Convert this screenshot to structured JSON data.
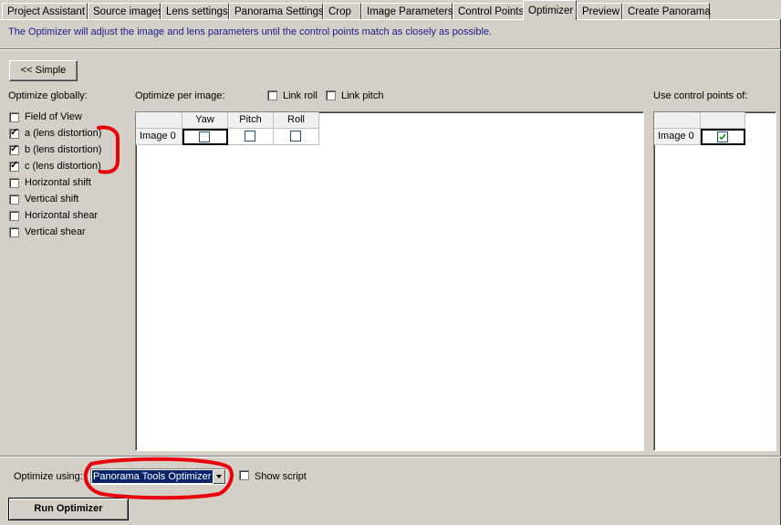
{
  "tabs": [
    {
      "label": "Project Assistant"
    },
    {
      "label": "Source images"
    },
    {
      "label": "Lens settings"
    },
    {
      "label": "Panorama Settings"
    },
    {
      "label": "Crop"
    },
    {
      "label": "Image Parameters"
    },
    {
      "label": "Control Points"
    },
    {
      "label": "Optimizer"
    },
    {
      "label": "Preview"
    },
    {
      "label": "Create Panorama"
    }
  ],
  "active_tab": "Optimizer",
  "info_text": "The Optimizer will adjust the image and lens parameters until the control points match as closely as possible.",
  "simple_button": "<< Simple",
  "optimize_globally": {
    "heading": "Optimize globally:",
    "options": [
      {
        "label": "Field of View",
        "checked": false
      },
      {
        "label": "a (lens distortion)",
        "checked": true
      },
      {
        "label": "b (lens distortion)",
        "checked": true
      },
      {
        "label": "c (lens distortion)",
        "checked": true
      },
      {
        "label": "Horizontal shift",
        "checked": false
      },
      {
        "label": "Vertical shift",
        "checked": false
      },
      {
        "label": "Horizontal shear",
        "checked": false
      },
      {
        "label": "Vertical shear",
        "checked": false
      }
    ]
  },
  "per_image": {
    "heading": "Optimize per image:",
    "link_roll": "Link roll",
    "link_pitch": "Link pitch",
    "columns": [
      "Yaw",
      "Pitch",
      "Roll"
    ],
    "rows": [
      {
        "label": "Image 0",
        "yaw": false,
        "pitch": false,
        "roll": false
      }
    ]
  },
  "control_points": {
    "heading": "Use control points of:",
    "rows": [
      {
        "label": "Image 0",
        "checked": true
      }
    ]
  },
  "optimize_using": {
    "label": "Optimize using:",
    "selected": "Panorama Tools Optimizer",
    "show_script": "Show script"
  },
  "run_button": "Run Optimizer",
  "colors": {
    "annotation": "#e8000b",
    "selection": "#0a246a",
    "info_text": "#1a1a8c"
  }
}
